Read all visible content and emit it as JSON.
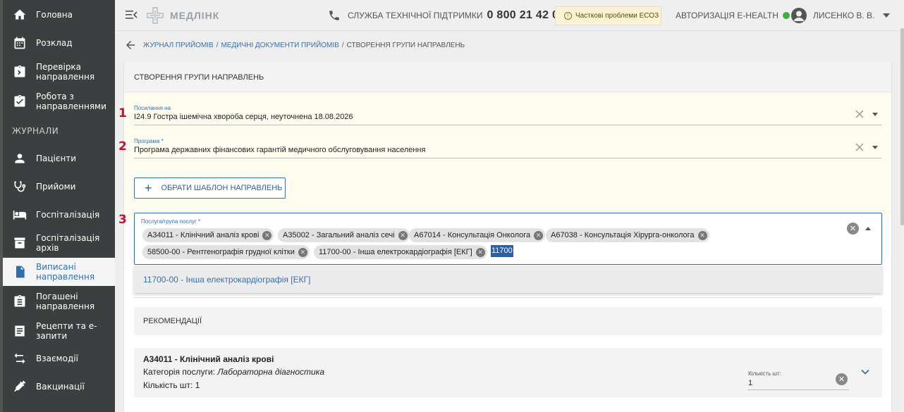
{
  "sidebar": {
    "items_top": [
      {
        "label": "Головна",
        "icon": "home-icon"
      },
      {
        "label": "Розклад",
        "icon": "calendar-icon"
      },
      {
        "label": "Перевірка направлення",
        "icon": "clipboard-search-icon"
      },
      {
        "label": "Робота з направленнями",
        "icon": "clipboard-check-icon"
      }
    ],
    "section_header": "ЖУРНАЛИ",
    "items_journals": [
      {
        "label": "Пацієнти",
        "icon": "person-icon"
      },
      {
        "label": "Прийоми",
        "icon": "stethoscope-icon"
      },
      {
        "label": "Госпіталізація",
        "icon": "bed-icon"
      },
      {
        "label": "Госпіталізація архів",
        "icon": "archive-icon"
      },
      {
        "label": "Виписані направлення",
        "icon": "document-icon",
        "active": true
      },
      {
        "label": "Погашені направлення",
        "icon": "clipboard-icon"
      },
      {
        "label": "Рецепти та е-запити",
        "icon": "list-icon"
      },
      {
        "label": "Взаємодії",
        "icon": "swap-icon"
      },
      {
        "label": "Вакцинації",
        "icon": "syringe-icon"
      }
    ]
  },
  "header": {
    "logo_text": "МЕДЛІНК",
    "support_label": "СЛУЖБА ТЕХНІЧНОЇ ПІДТРИМКИ",
    "support_phone": "0 800 21 42 00",
    "ecoz_notice": "Часткові проблеми ЕСОЗ",
    "ehealth_label": "АВТОРИЗАЦІЯ E-HEALTH",
    "ehealth_status_color": "#3cb043",
    "user_name": "ЛИСЕНКО В. В."
  },
  "breadcrumb": {
    "items": [
      "ЖУРНАЛ ПРИЙОМІВ",
      "МЕДИЧНІ ДОКУМЕНТИ ПРИЙОМІВ"
    ],
    "current": "СТВОРЕННЯ ГРУПИ НАПРАВЛЕНЬ"
  },
  "form": {
    "title": "СТВОРЕННЯ ГРУПИ НАПРАВЛЕНЬ",
    "markers": [
      "1",
      "2",
      "3"
    ],
    "reference": {
      "label": "Посилання на",
      "value": "I24.9 Гостра ішемічна хвороба серця, неуточнена 18.08.2026"
    },
    "program": {
      "label": "Програма *",
      "value": "Програма державних фінансових гарантій медичного обслуговування населення"
    },
    "template_button": "ОБРАТИ ШАБЛОН НАПРАВЛЕНЬ",
    "services": {
      "label": "Послуга/група послуг *",
      "chips": [
        "А34011 - Клінічний аналіз крові",
        "А35002 - Загальний аналіз сечі",
        "А67014 - Консультація Онколога",
        "А67038 - Консультація Хірурга-онколога",
        "58500-00 - Рентгенографія грудної клітки",
        "11700-00 - Інша електрокардіографія [ЕКГ]"
      ],
      "search_text": "11700",
      "dropdown_option": "11700-00 - Інша електрокардіографія [ЕКГ]"
    },
    "recommendations_header": "РЕКОМЕНДАЦІЇ",
    "service_card": {
      "title": "А34011 - Клінічний аналіз крові",
      "category_label": "Категорія послуги:",
      "category_value": "Лабораторна діагностика",
      "qty_text": "Кількість шт: 1",
      "qty_field_label": "Кількість шт:",
      "qty_field_value": "1"
    }
  }
}
